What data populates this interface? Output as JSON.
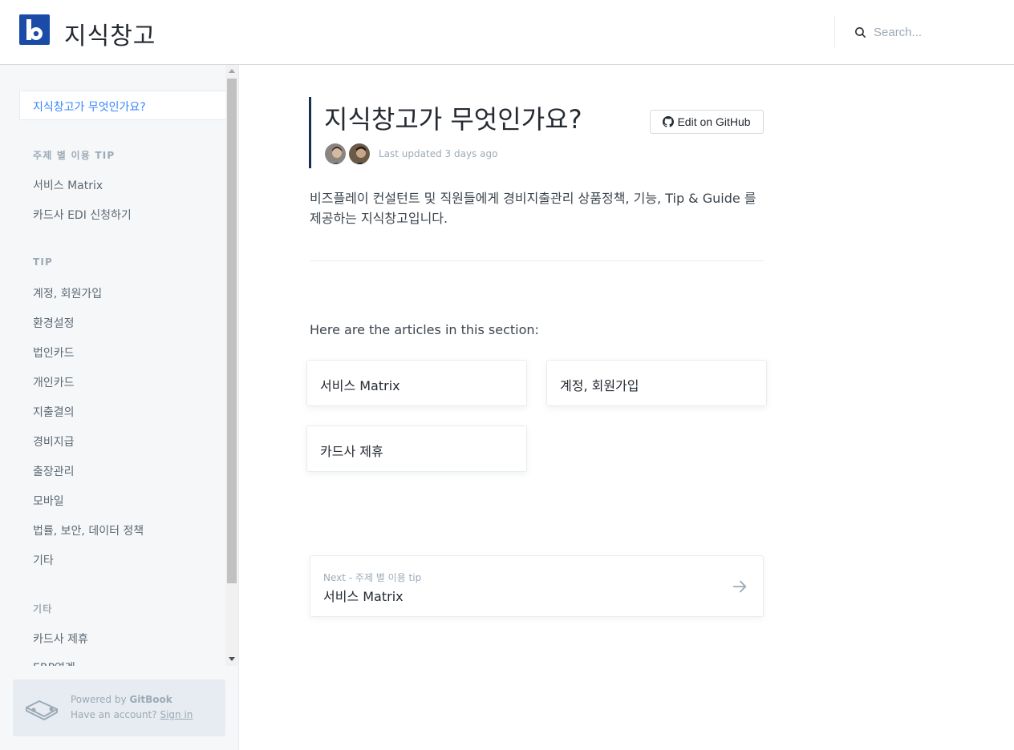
{
  "brand": {
    "logo_letter": "b",
    "title": "지식창고",
    "accent_color": "#1a4ba7"
  },
  "search": {
    "placeholder": "Search...",
    "icon": "search-icon"
  },
  "sidebar": {
    "active_item": "지식창고가 무엇인가요?",
    "groups": [
      {
        "title": "주제 별 이용 TIP",
        "items": [
          "서비스 Matrix",
          "카드사 EDI 신청하기"
        ]
      },
      {
        "title": "TIP",
        "items": [
          "계정, 회원가입",
          "환경설정",
          "법인카드",
          "개인카드",
          "지출결의",
          "경비지급",
          "출장관리",
          "모바일",
          "법률, 보안, 데이터 정책",
          "기타"
        ]
      },
      {
        "title": "기타",
        "items": [
          "카드사 제휴",
          "ERP연계"
        ]
      }
    ],
    "powered": {
      "prefix": "Powered by ",
      "brand": "GitBook",
      "account_text": "Have an account? ",
      "signin": "Sign in"
    }
  },
  "page": {
    "title": "지식창고가 무엇인가요?",
    "edit_button": "Edit on GitHub",
    "last_updated": "Last updated 3 days ago",
    "intro": "비즈플레이 컨설턴트 및 직원들에게 경비지출관리 상품정책, 기능, Tip & Guide 를 제공하는 지식창고입니다.",
    "section_label": "Here are the articles in this section:",
    "articles": [
      "서비스 Matrix",
      "계정, 회원가입",
      "카드사 제휴"
    ],
    "next": {
      "label": "Next - 주제 별 이용 tip",
      "title": "서비스 Matrix"
    }
  }
}
